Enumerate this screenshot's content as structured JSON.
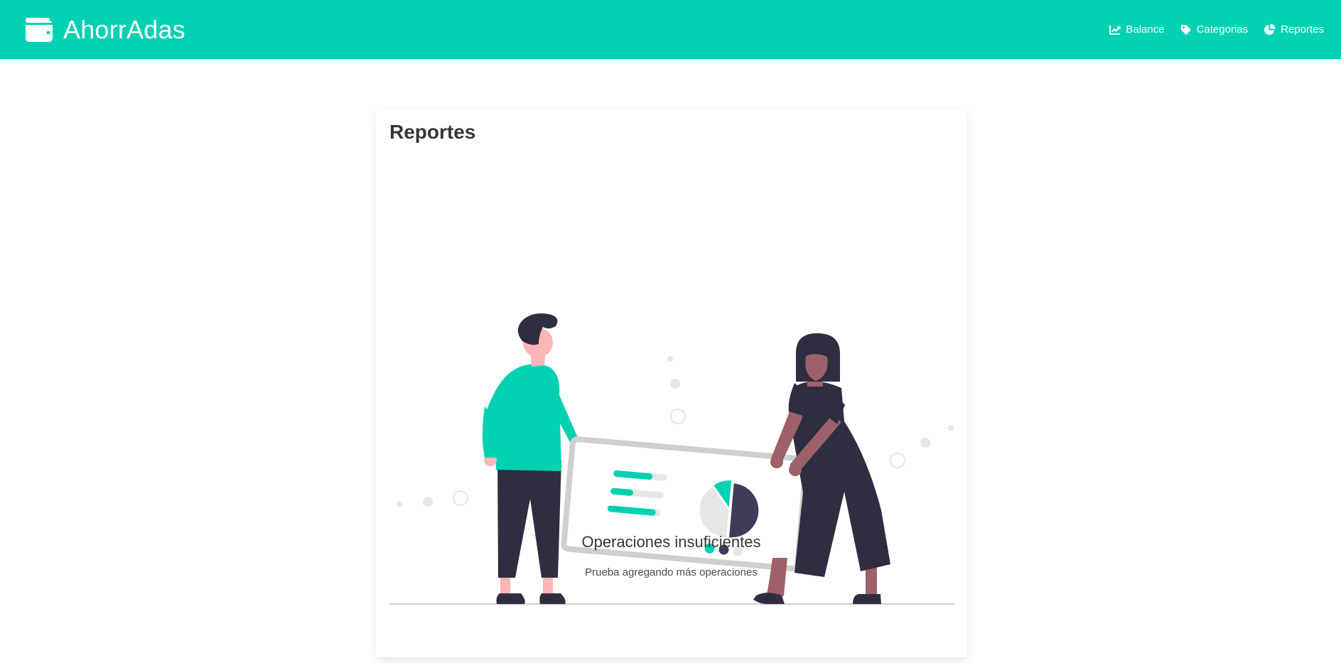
{
  "navbar": {
    "brand_icon": "wallet-icon",
    "brand_name": "AhorrAdas",
    "accent_color": "#00d1b2",
    "items": [
      {
        "label": "Balance",
        "icon": "chart-line-icon"
      },
      {
        "label": "Categorias",
        "icon": "tag-icon"
      },
      {
        "label": "Reportes",
        "icon": "chart-pie-icon"
      }
    ]
  },
  "reports": {
    "title": "Reportes",
    "illustration": "people-holding-report-board-illustration",
    "empty_title": "Operaciones insuficientes",
    "empty_subtitle": "Prueba agregando más operaciones"
  }
}
